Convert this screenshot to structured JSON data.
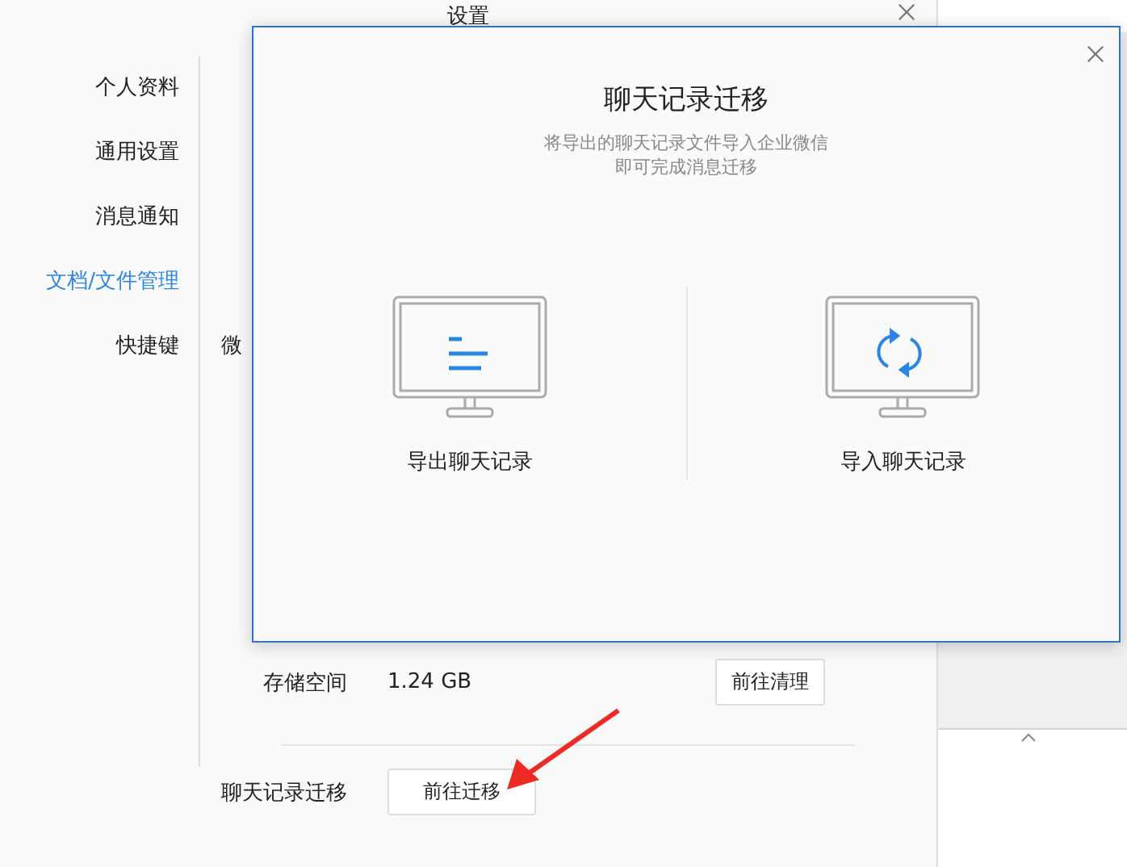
{
  "settings_window": {
    "title": "设置",
    "sidebar": {
      "items": [
        {
          "label": "个人资料",
          "selected": false
        },
        {
          "label": "通用设置",
          "selected": false
        },
        {
          "label": "消息通知",
          "selected": false
        },
        {
          "label": "文档/文件管理",
          "selected": true
        },
        {
          "label": "快捷键",
          "selected": false
        }
      ]
    },
    "partial_text": "微",
    "storage": {
      "label": "存储空间",
      "value": "1.24 GB",
      "button": "前往清理"
    },
    "migration": {
      "label": "聊天记录迁移",
      "button": "前往迁移"
    }
  },
  "dialog": {
    "title": "聊天记录迁移",
    "subtitle_lines": [
      "将导出的聊天记录文件导入企业微信",
      "即可完成消息迁移"
    ],
    "options": [
      {
        "kind": "export",
        "label": "导出聊天记录"
      },
      {
        "kind": "import",
        "label": "导入聊天记录"
      }
    ]
  }
}
